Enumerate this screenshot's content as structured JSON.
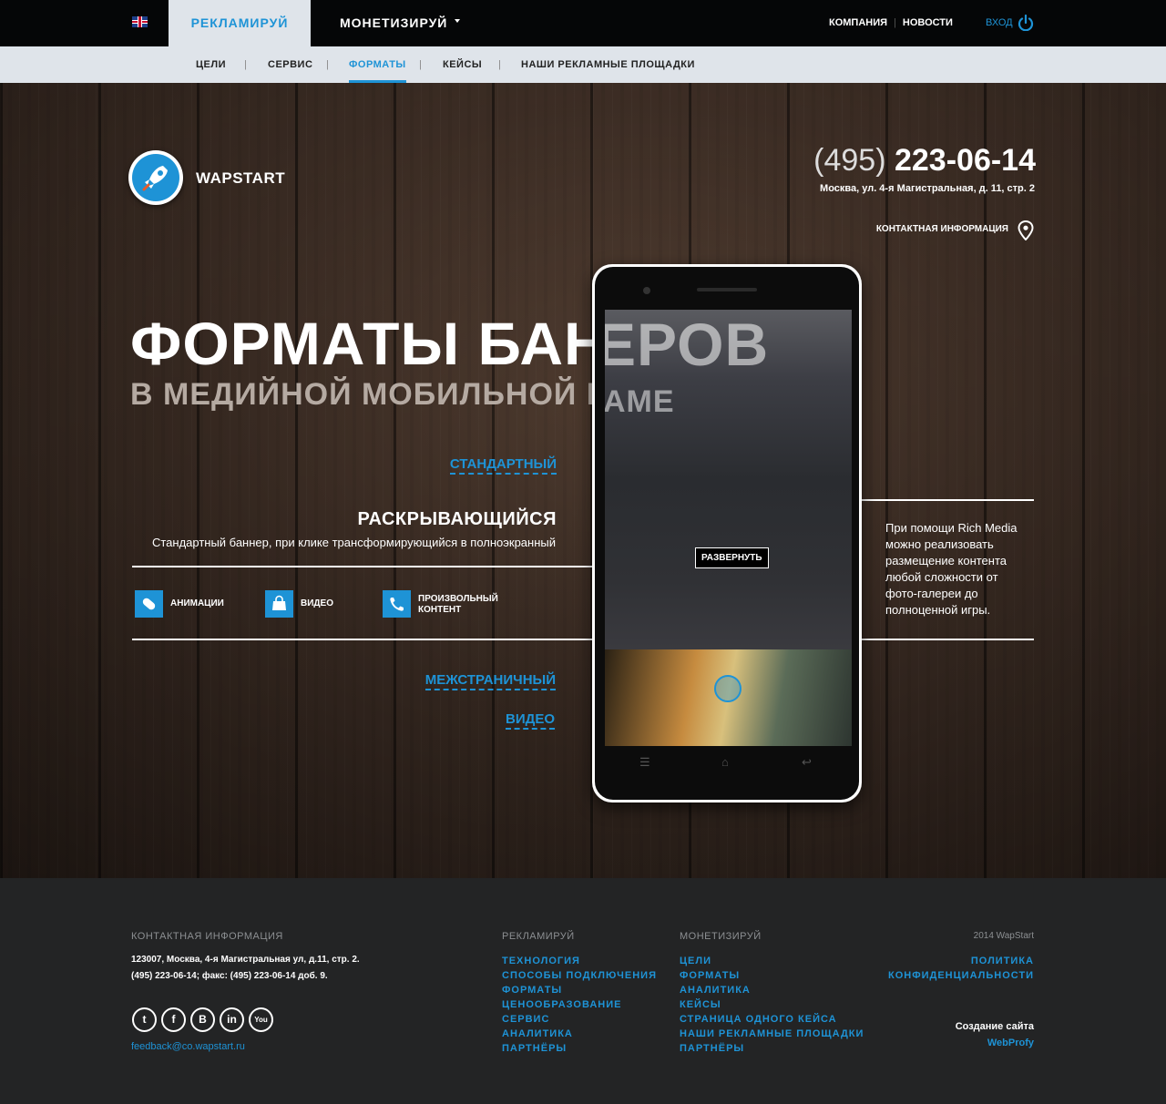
{
  "topbar": {
    "language_icon": "uk-flag-icon",
    "tab_advertise": "РЕКЛАМИРУЙ",
    "tab_monetize": "МОНЕТИЗИРУЙ",
    "link_company": "КОМПАНИЯ",
    "link_news": "НОВОСТИ",
    "login": "ВХОД"
  },
  "subnav": {
    "items": [
      "ЦЕЛИ",
      "СЕРВИС",
      "ФОРМАТЫ",
      "КЕЙСЫ",
      "НАШИ РЕКЛАМНЫЕ ПЛОЩАДКИ"
    ],
    "active": "ФОРМАТЫ"
  },
  "hero": {
    "logo_text": "WAPSTART",
    "phone_code": "(495)",
    "phone_number": "223-06-14",
    "address": "Москва, ул. 4-я Магистральная, д. 11, стр. 2",
    "contact_link": "КОНТАКТНАЯ ИНФОРМАЦИЯ",
    "title": "ФОРМАТЫ БАННЕРОВ",
    "title_visible": "ФОРМАТЫ БАНН",
    "subtitle": "В МЕДИЙНОЙ МОБИЛЬНОЙ РЕКЛАМЕ",
    "subtitle_visible": "В МЕДИЙНОЙ МОБИЛЬНОЙ РЕКЛ",
    "format_standard": "СТАНДАРТНЫЙ",
    "format_expanding_title": "РАСКРЫВАЮЩИЙСЯ",
    "format_expanding_desc": "Стандартный баннер, при клике трансформирующийся в полноэкранный",
    "features": [
      {
        "label": "АНИМАЦИИ",
        "icon": "pill-icon"
      },
      {
        "label": "ВИДЕО",
        "icon": "bag-icon"
      },
      {
        "label_line1": "ПРОИЗВОЛЬНЫЙ",
        "label_line2": "КОНТЕНТ",
        "icon": "phone-icon"
      }
    ],
    "format_interstitial": "МЕЖСТРАНИЧНЫЙ",
    "format_video": "ВИДЕО",
    "right_text": "При помощи Rich Media можно реализовать размещение контента любой сложности от фото-галереи до полноценной игры.",
    "phone_screen_text1": "ЕРОВ",
    "phone_screen_text2": "АМЕ",
    "expand_button": "РАЗВЕРНУТЬ"
  },
  "footer": {
    "contact_head": "КОНТАКТНАЯ ИНФОРМАЦИЯ",
    "address": "123007, Москва, 4-я Магистральная ул, д.11, стр. 2.",
    "phones": "(495) 223-06-14; факс: (495) 223-06-14 доб. 9.",
    "email": "feedback@co.wapstart.ru",
    "socials": [
      "twitter-icon",
      "facebook-icon",
      "vk-icon",
      "linkedin-icon",
      "youtube-icon"
    ],
    "advertise_head": "РЕКЛАМИРУЙ",
    "advertise_links": [
      "ТЕХНОЛОГИЯ",
      "СПОСОБЫ ПОДКЛЮЧЕНИЯ",
      "ФОРМАТЫ",
      "ЦЕНООБРАЗОВАНИЕ",
      "СЕРВИС",
      "АНАЛИТИКА",
      "ПАРТНЁРЫ"
    ],
    "monetize_head": "МОНЕТИЗИРУЙ",
    "monetize_links": [
      "ЦЕЛИ",
      "ФОРМАТЫ",
      "АНАЛИТИКА",
      "КЕЙСЫ",
      "СТРАНИЦА ОДНОГО КЕЙСА",
      "НАШИ РЕКЛАМНЫЕ ПЛОЩАДКИ",
      "ПАРТНЁРЫ"
    ],
    "copyright": "2014 WapStart",
    "policy": "ПОЛИТИКА КОНФИДЕНЦИАЛЬНОСТИ",
    "made_by_label": "Создание сайта",
    "made_by": "WebProfy"
  },
  "colors": {
    "accent": "#1e93d6",
    "topbar": "#050607",
    "subnav": "#dfe4ea",
    "footer": "#232425"
  }
}
